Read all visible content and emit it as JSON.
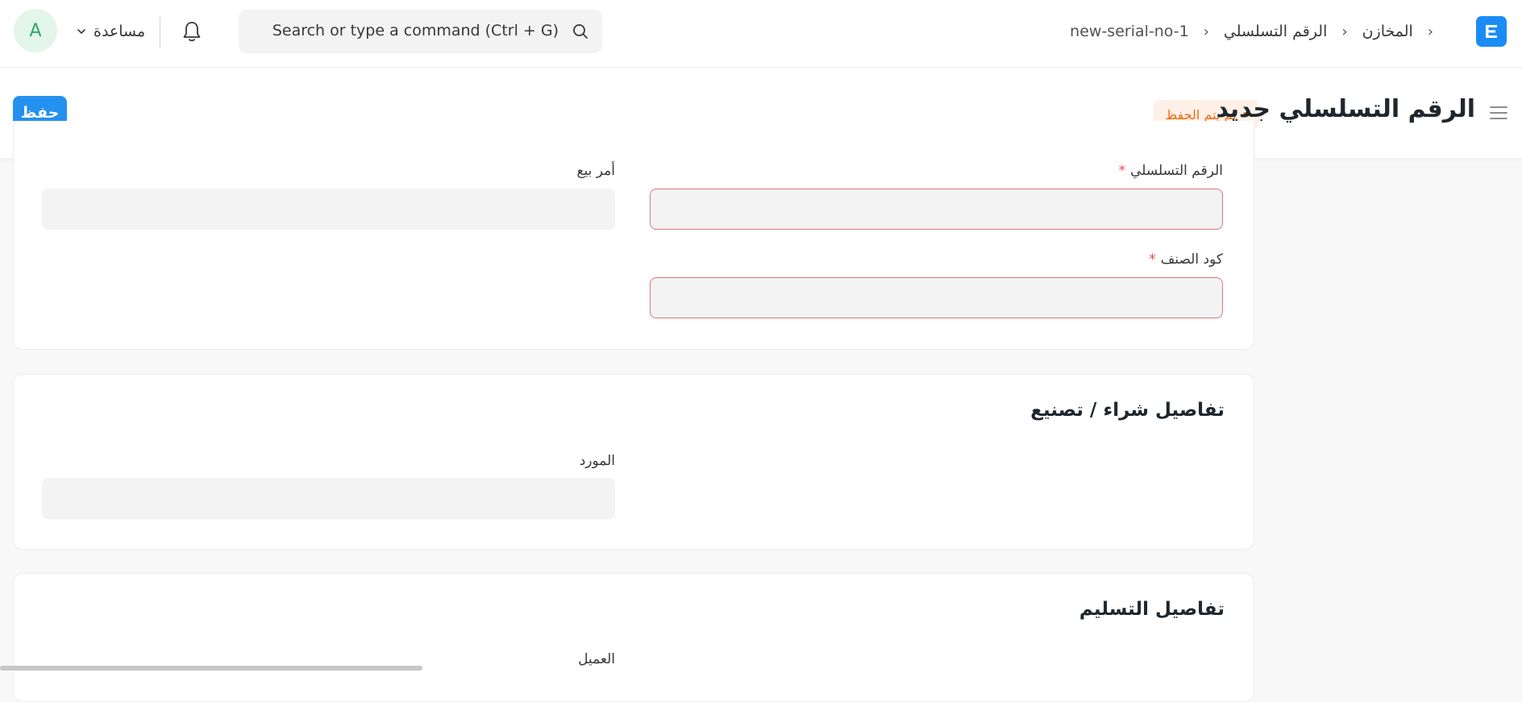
{
  "navbar": {
    "avatar_initial": "A",
    "help_label": "مساعدة",
    "search_placeholder": "Search or type a command (Ctrl + G)",
    "breadcrumbs": [
      "المخازن",
      "الرقم التسلسلي",
      "new-serial-no-1"
    ]
  },
  "page": {
    "title": "الرقم التسلسلي جديد",
    "status": "لم يتم الحفظ",
    "save_label": "حفظ"
  },
  "form": {
    "serial_no_label": "الرقم التسلسلي",
    "item_code_label": "كود الصنف",
    "sales_order_label": "أمر بيع",
    "required_mark": "*",
    "purchase_section_title": "تفاصيل شراء / تصنيع",
    "supplier_label": "المورد",
    "delivery_section_title": "تفاصيل التسليم",
    "customer_label": "العميل"
  },
  "colors": {
    "primary": "#2490ef",
    "status_orange": "#e86c13",
    "required_red": "#e24c4c"
  }
}
